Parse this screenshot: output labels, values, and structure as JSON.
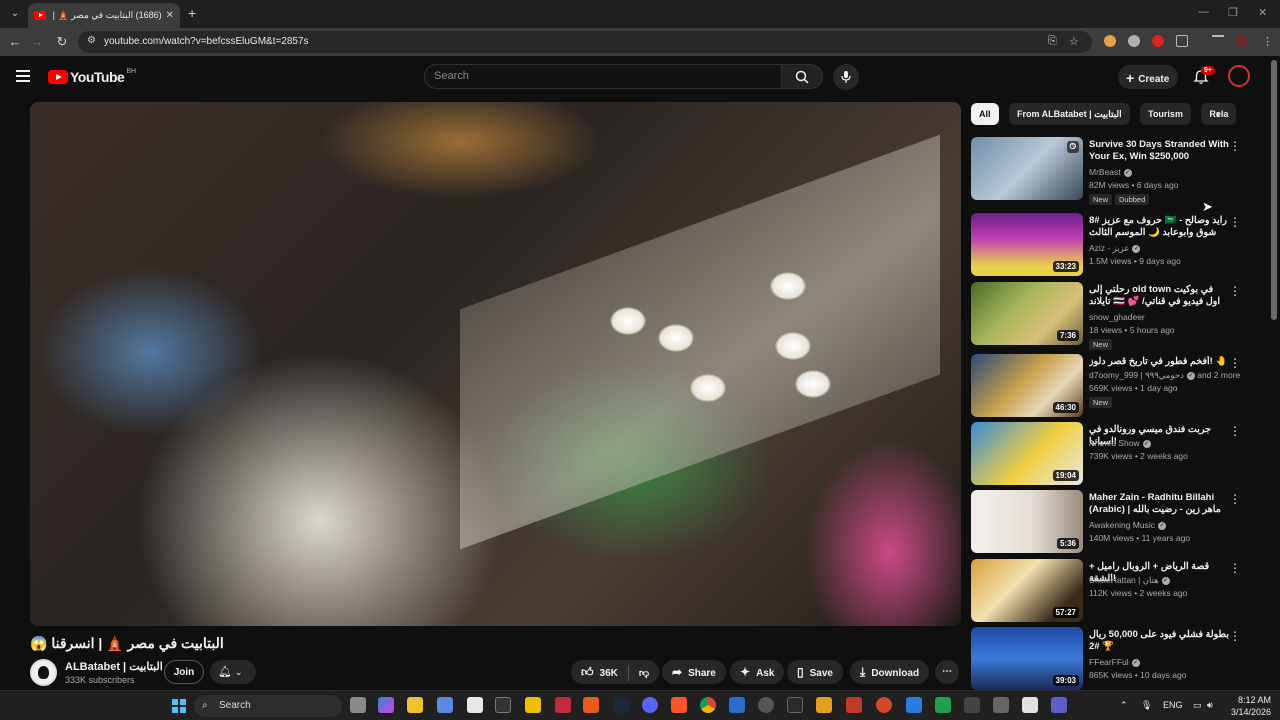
{
  "browser": {
    "tab_title": "(1686) البتابيت في مصر 🛕 | ال...",
    "url": "youtube.com/watch?v=befcssEluGM&t=2857s"
  },
  "header": {
    "logo_text": "YouTube",
    "country_code": "BH",
    "search_placeholder": "Search",
    "create_label": "Create",
    "notification_count": "9+"
  },
  "video": {
    "title": "😱 البتابيت في مصر 🛕 | انسرقنا",
    "channel_name": "ALBatabet | البتابيت",
    "subscribers": "333K subscribers",
    "join_label": "Join",
    "like_count": "36K",
    "share_label": "Share",
    "ask_label": "Ask",
    "save_label": "Save",
    "download_label": "Download"
  },
  "chips": [
    "All",
    "From ALBatabet | البتابيت",
    "Tourism",
    "Rela"
  ],
  "recommendations": [
    {
      "title": "Survive 30 Days Stranded With Your Ex, Win $250,000",
      "channel": "MrBeast",
      "meta": "82M views • 6 days ago",
      "badges": [
        "New",
        "Dubbed"
      ],
      "duration": ""
    },
    {
      "title": "حروف مع عزيز #8 🇸🇦 رايد وصالح - شوق وابوعابد 🌙 الموسم الثالث",
      "channel": "Aziz - عزيز",
      "meta": "1.5M views • 9 days ago",
      "badges": [],
      "duration": "33:23"
    },
    {
      "title": "رحلتي إلى old town في بوكيت تايلاند 🇹🇭 💕 /اول فيديو في قناتي",
      "channel": "snow_ghadeer",
      "meta": "18 views • 5 hours ago",
      "badges": [
        "New"
      ],
      "duration": "7:36"
    },
    {
      "title": "أفخم فطور في تاريخ قصر دلوز! 🤚",
      "channel": "d7oomy_999 | دحومي٩٩٩",
      "channel_extra": "and 2 more",
      "meta": "569K views • 1 day ago",
      "badges": [
        "New"
      ],
      "duration": "46:30"
    },
    {
      "title": "جربت فندق ميسي ورونالدو في اسبانيا!",
      "channel": "Ahmed Show",
      "meta": "739K views • 2 weeks ago",
      "badges": [],
      "duration": "19:04"
    },
    {
      "title": "Maher Zain - Radhitu Billahi (Arabic) | ماهر زين - رضيت بالله ربا |...",
      "channel": "Awakening Music",
      "meta": "140M views • 11 years ago",
      "badges": [],
      "duration": "5:36"
    },
    {
      "title": "قصة الرياض + الروبال راميل + الشقة!",
      "channel": "UncleHattan | هتان",
      "meta": "112K views • 2 weeks ago",
      "badges": [],
      "duration": "57:27"
    },
    {
      "title": "بطولة فشلي فيود على 50,000 ريال #2 🏆",
      "channel": "FFearFFul",
      "meta": "865K views • 10 days ago",
      "badges": [],
      "duration": "39:03"
    }
  ],
  "taskbar": {
    "search_label": "Search",
    "lang": "ENG",
    "time": "8:12 AM",
    "date": "3/14/2026"
  },
  "colors": {
    "background": "#0f0f0f",
    "brand": "#ff0000",
    "surface": "#272727",
    "secondary_text": "#aaaaaa"
  }
}
